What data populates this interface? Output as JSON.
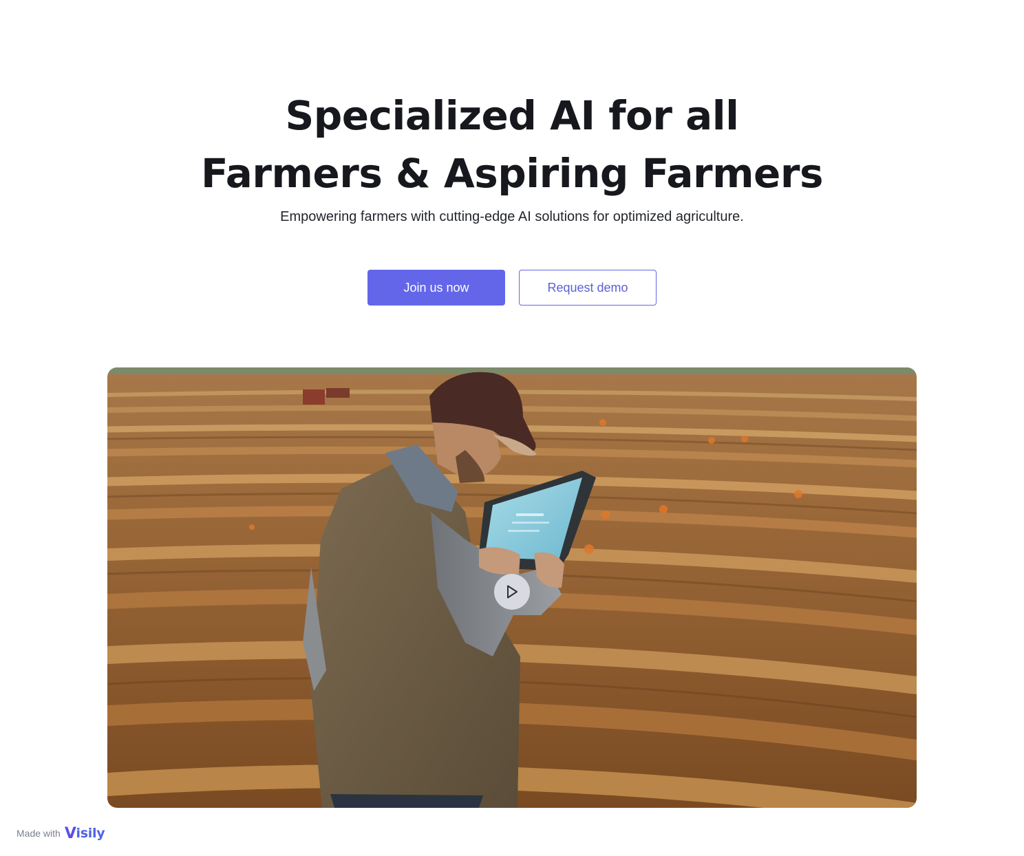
{
  "hero": {
    "title_line1": "Specialized AI for all",
    "title_line2": "Farmers & Aspiring Farmers",
    "subtitle": "Empowering farmers with cutting-edge AI solutions for optimized agriculture.",
    "primary_cta": "Join us now",
    "secondary_cta": "Request demo"
  },
  "media": {
    "play_icon": "play-icon",
    "image_icon": "farmer-with-tablet-in-wheat-field"
  },
  "footer_badge": {
    "prefix": "Made with",
    "brand": "isily",
    "brand_mark": "V"
  },
  "colors": {
    "accent": "#6366e8",
    "heading": "#16181d",
    "badge_brand": "#4f63e8"
  }
}
